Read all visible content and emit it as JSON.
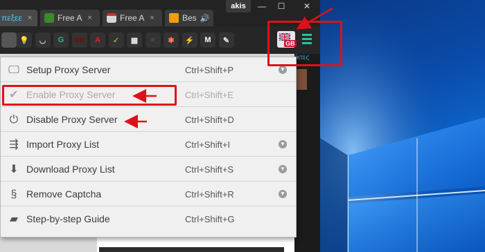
{
  "browser": {
    "tabs": [
      {
        "label": "πεξεε",
        "active": true,
        "close": "×"
      },
      {
        "label": "Free A",
        "active": false,
        "close": "×"
      },
      {
        "label": "Free A",
        "active": false,
        "close": "×"
      },
      {
        "label": "Bes",
        "active": false,
        "close": ""
      }
    ],
    "profile_name": "akis",
    "window_controls": {
      "minimize": "—",
      "maximize": "☐",
      "close": "✕"
    },
    "bookmarks_partial": "ίκτες"
  },
  "extensions": [
    {
      "name": "lightbulb-ext",
      "glyph": "💡",
      "color": "#cfcfcf"
    },
    {
      "name": "pocket-ext",
      "glyph": "◡",
      "color": "#cfcfcf"
    },
    {
      "name": "grammarly-ext",
      "glyph": "G",
      "color": "#15c39a"
    },
    {
      "name": "ublock-ext",
      "glyph": "uo",
      "color": "#800000"
    },
    {
      "name": "avira-ext",
      "glyph": "A",
      "color": "#e31f26"
    },
    {
      "name": "shield-ext",
      "glyph": "✓",
      "color": "#7ab648"
    },
    {
      "name": "trello-ext",
      "glyph": "▦",
      "color": "#e8e8e8"
    },
    {
      "name": "dark-ext",
      "glyph": "■",
      "color": "#444444"
    },
    {
      "name": "hubspot-ext",
      "glyph": "✱",
      "color": "#ff7a59"
    },
    {
      "name": "flash-ext",
      "glyph": "⚡",
      "color": "#e8e8e8"
    },
    {
      "name": "gmail-ext",
      "glyph": "M",
      "color": "#ffffff"
    },
    {
      "name": "feather-ext",
      "glyph": "✎",
      "color": "#e8e8e8"
    }
  ],
  "gb_badge": "GB",
  "menu": {
    "items": [
      {
        "label": "Setup Proxy Server",
        "shortcut": "Ctrl+Shift+P",
        "icon": "monitor-icon",
        "glyph": "🖵",
        "disabled": false,
        "chevron": true
      },
      {
        "label": "Enable Proxy Server",
        "shortcut": "Ctrl+Shift+E",
        "icon": "checkmark-icon",
        "glyph": "✔",
        "disabled": true,
        "chevron": false
      },
      {
        "label": "Disable Proxy Server",
        "shortcut": "Ctrl+Shift+D",
        "icon": "power-icon",
        "glyph": "⏻",
        "disabled": false,
        "chevron": false
      },
      {
        "label": "Import Proxy List",
        "shortcut": "Ctrl+Shift+I",
        "icon": "import-icon",
        "glyph": "⇶",
        "disabled": false,
        "chevron": true
      },
      {
        "label": "Download Proxy List",
        "shortcut": "Ctrl+Shift+S",
        "icon": "download-icon",
        "glyph": "⬇",
        "disabled": false,
        "chevron": true
      },
      {
        "label": "Remove Captcha",
        "shortcut": "Ctrl+Shift+R",
        "icon": "captcha-icon",
        "glyph": "§",
        "disabled": false,
        "chevron": true
      },
      {
        "label": "Step-by-step Guide",
        "shortcut": "Ctrl+Shift+G",
        "icon": "book-icon",
        "glyph": "▰",
        "disabled": false,
        "chevron": false
      }
    ],
    "chevron_glyph": "▼"
  },
  "colors": {
    "annotation_red": "#e0101a",
    "menu_bg": "#f0f0f0",
    "desktop_blue": "#0a4aa8"
  }
}
